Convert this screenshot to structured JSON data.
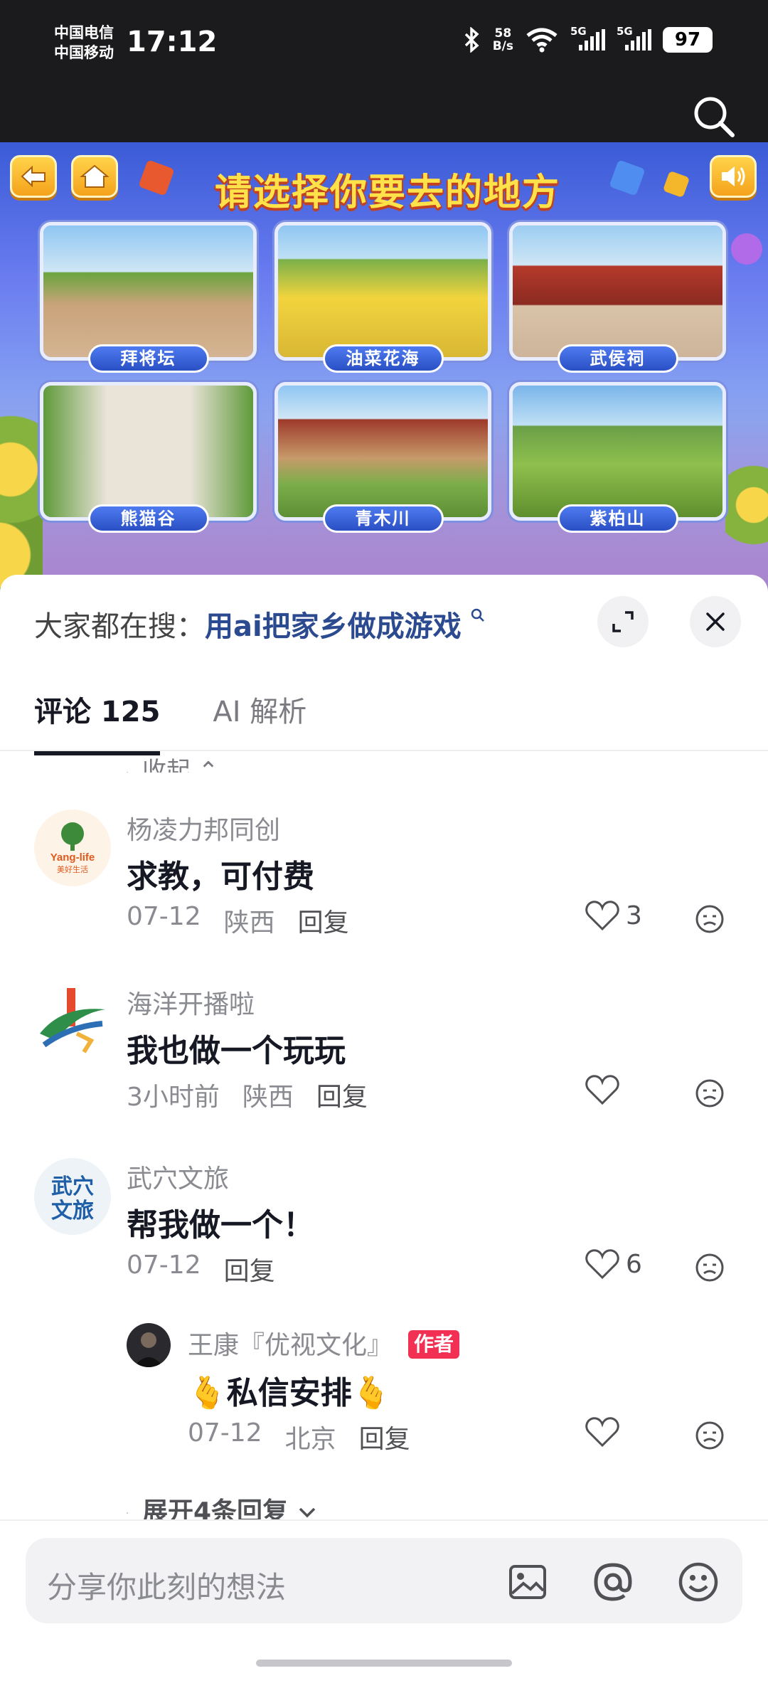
{
  "status_bar": {
    "carrier1": "中国电信",
    "carrier2": "中国移动",
    "time": "17:12",
    "net_speed_value": "58",
    "net_speed_unit": "B/s",
    "signal1_label": "5G",
    "signal2_label": "5G",
    "battery": "97"
  },
  "banner": {
    "title": "请选择你要去的地方",
    "places": [
      {
        "label": "拜将坛"
      },
      {
        "label": "油菜花海"
      },
      {
        "label": "武侯祠"
      },
      {
        "label": "熊猫谷"
      },
      {
        "label": "青木川"
      },
      {
        "label": "紫柏山"
      }
    ]
  },
  "sheet": {
    "search_prefix": "大家都在搜：",
    "search_query": "用ai把家乡做成游戏",
    "tabs": [
      {
        "label": "评论 125",
        "active": true
      },
      {
        "label": "AI 解析",
        "active": false
      }
    ],
    "collapse_label": "收起",
    "comments": [
      {
        "user": "杨凌力邦同创",
        "text": "求教，可付费",
        "date": "07-12",
        "location": "陕西",
        "reply": "回复",
        "likes": "3"
      },
      {
        "user": "海洋开播啦",
        "text": "我也做一个玩玩",
        "date": "3小时前",
        "location": "陕西",
        "reply": "回复",
        "likes": ""
      },
      {
        "user": "武穴文旅",
        "text": "帮我做一个！",
        "date": "07-12",
        "location": "",
        "reply": "回复",
        "likes": "6"
      }
    ],
    "reply": {
      "user": "王康『优视文化』",
      "badge": "作者",
      "text": "私信安排",
      "date": "07-12",
      "location": "北京",
      "reply": "回复",
      "likes": ""
    },
    "expand_label": "展开4条回复",
    "avatar_text": {
      "a1_line1": "Yang-life",
      "a1_line2": "美好生活",
      "a3_line1": "武穴",
      "a3_line2": "文旅"
    }
  },
  "input": {
    "placeholder": "分享你此刻的想法"
  }
}
